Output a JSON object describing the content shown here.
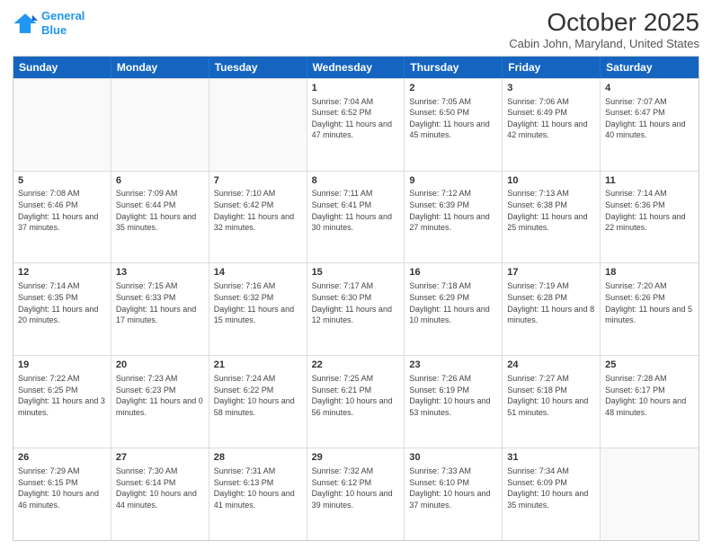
{
  "logo": {
    "line1": "General",
    "line2": "Blue"
  },
  "title": "October 2025",
  "location": "Cabin John, Maryland, United States",
  "dayHeaders": [
    "Sunday",
    "Monday",
    "Tuesday",
    "Wednesday",
    "Thursday",
    "Friday",
    "Saturday"
  ],
  "weeks": [
    [
      {
        "day": "",
        "info": ""
      },
      {
        "day": "",
        "info": ""
      },
      {
        "day": "",
        "info": ""
      },
      {
        "day": "1",
        "info": "Sunrise: 7:04 AM\nSunset: 6:52 PM\nDaylight: 11 hours and 47 minutes."
      },
      {
        "day": "2",
        "info": "Sunrise: 7:05 AM\nSunset: 6:50 PM\nDaylight: 11 hours and 45 minutes."
      },
      {
        "day": "3",
        "info": "Sunrise: 7:06 AM\nSunset: 6:49 PM\nDaylight: 11 hours and 42 minutes."
      },
      {
        "day": "4",
        "info": "Sunrise: 7:07 AM\nSunset: 6:47 PM\nDaylight: 11 hours and 40 minutes."
      }
    ],
    [
      {
        "day": "5",
        "info": "Sunrise: 7:08 AM\nSunset: 6:46 PM\nDaylight: 11 hours and 37 minutes."
      },
      {
        "day": "6",
        "info": "Sunrise: 7:09 AM\nSunset: 6:44 PM\nDaylight: 11 hours and 35 minutes."
      },
      {
        "day": "7",
        "info": "Sunrise: 7:10 AM\nSunset: 6:42 PM\nDaylight: 11 hours and 32 minutes."
      },
      {
        "day": "8",
        "info": "Sunrise: 7:11 AM\nSunset: 6:41 PM\nDaylight: 11 hours and 30 minutes."
      },
      {
        "day": "9",
        "info": "Sunrise: 7:12 AM\nSunset: 6:39 PM\nDaylight: 11 hours and 27 minutes."
      },
      {
        "day": "10",
        "info": "Sunrise: 7:13 AM\nSunset: 6:38 PM\nDaylight: 11 hours and 25 minutes."
      },
      {
        "day": "11",
        "info": "Sunrise: 7:14 AM\nSunset: 6:36 PM\nDaylight: 11 hours and 22 minutes."
      }
    ],
    [
      {
        "day": "12",
        "info": "Sunrise: 7:14 AM\nSunset: 6:35 PM\nDaylight: 11 hours and 20 minutes."
      },
      {
        "day": "13",
        "info": "Sunrise: 7:15 AM\nSunset: 6:33 PM\nDaylight: 11 hours and 17 minutes."
      },
      {
        "day": "14",
        "info": "Sunrise: 7:16 AM\nSunset: 6:32 PM\nDaylight: 11 hours and 15 minutes."
      },
      {
        "day": "15",
        "info": "Sunrise: 7:17 AM\nSunset: 6:30 PM\nDaylight: 11 hours and 12 minutes."
      },
      {
        "day": "16",
        "info": "Sunrise: 7:18 AM\nSunset: 6:29 PM\nDaylight: 11 hours and 10 minutes."
      },
      {
        "day": "17",
        "info": "Sunrise: 7:19 AM\nSunset: 6:28 PM\nDaylight: 11 hours and 8 minutes."
      },
      {
        "day": "18",
        "info": "Sunrise: 7:20 AM\nSunset: 6:26 PM\nDaylight: 11 hours and 5 minutes."
      }
    ],
    [
      {
        "day": "19",
        "info": "Sunrise: 7:22 AM\nSunset: 6:25 PM\nDaylight: 11 hours and 3 minutes."
      },
      {
        "day": "20",
        "info": "Sunrise: 7:23 AM\nSunset: 6:23 PM\nDaylight: 11 hours and 0 minutes."
      },
      {
        "day": "21",
        "info": "Sunrise: 7:24 AM\nSunset: 6:22 PM\nDaylight: 10 hours and 58 minutes."
      },
      {
        "day": "22",
        "info": "Sunrise: 7:25 AM\nSunset: 6:21 PM\nDaylight: 10 hours and 56 minutes."
      },
      {
        "day": "23",
        "info": "Sunrise: 7:26 AM\nSunset: 6:19 PM\nDaylight: 10 hours and 53 minutes."
      },
      {
        "day": "24",
        "info": "Sunrise: 7:27 AM\nSunset: 6:18 PM\nDaylight: 10 hours and 51 minutes."
      },
      {
        "day": "25",
        "info": "Sunrise: 7:28 AM\nSunset: 6:17 PM\nDaylight: 10 hours and 48 minutes."
      }
    ],
    [
      {
        "day": "26",
        "info": "Sunrise: 7:29 AM\nSunset: 6:15 PM\nDaylight: 10 hours and 46 minutes."
      },
      {
        "day": "27",
        "info": "Sunrise: 7:30 AM\nSunset: 6:14 PM\nDaylight: 10 hours and 44 minutes."
      },
      {
        "day": "28",
        "info": "Sunrise: 7:31 AM\nSunset: 6:13 PM\nDaylight: 10 hours and 41 minutes."
      },
      {
        "day": "29",
        "info": "Sunrise: 7:32 AM\nSunset: 6:12 PM\nDaylight: 10 hours and 39 minutes."
      },
      {
        "day": "30",
        "info": "Sunrise: 7:33 AM\nSunset: 6:10 PM\nDaylight: 10 hours and 37 minutes."
      },
      {
        "day": "31",
        "info": "Sunrise: 7:34 AM\nSunset: 6:09 PM\nDaylight: 10 hours and 35 minutes."
      },
      {
        "day": "",
        "info": ""
      }
    ]
  ]
}
